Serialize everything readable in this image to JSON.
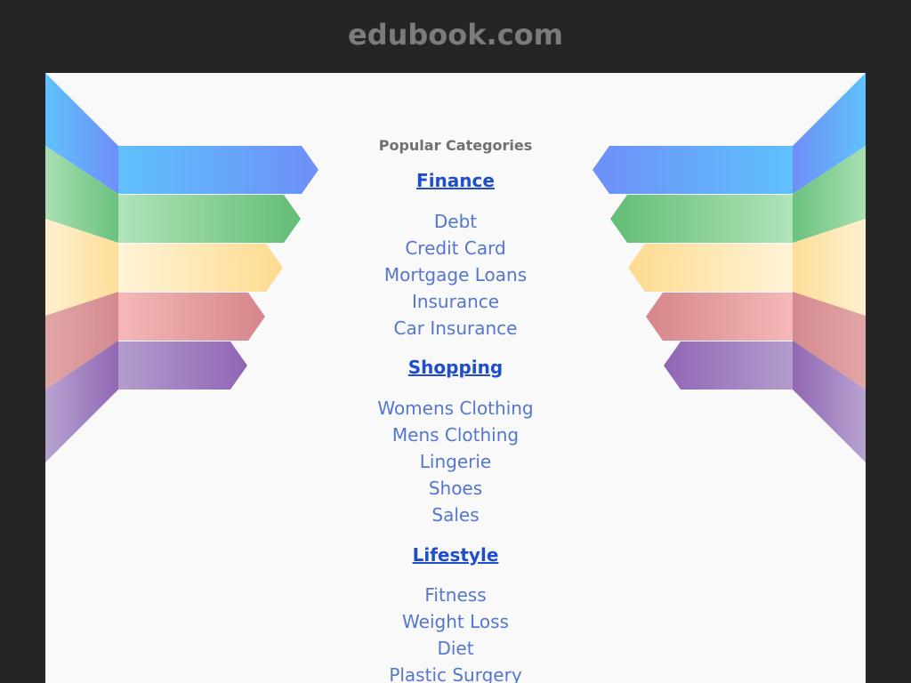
{
  "header": {
    "domain": "edubook.com"
  },
  "content": {
    "heading": "Popular Categories",
    "categories": [
      {
        "title": "Finance",
        "links": [
          "Debt",
          "Credit Card",
          "Mortgage Loans",
          "Insurance",
          "Car Insurance"
        ]
      },
      {
        "title": "Shopping",
        "links": [
          "Womens Clothing",
          "Mens Clothing",
          "Lingerie",
          "Shoes",
          "Sales"
        ]
      },
      {
        "title": "Lifestyle",
        "links": [
          "Fitness",
          "Weight Loss",
          "Diet",
          "Plastic Surgery"
        ]
      }
    ]
  },
  "colors": {
    "background": "#252525",
    "panel": "#f9f9f9",
    "domain_text": "#7b7b7b",
    "heading_text": "#707070",
    "category_link": "#1f4ecc",
    "sub_link": "#5377cf",
    "ribbon_blue": "#5fb8fb",
    "ribbon_green": "#72c783",
    "ribbon_yellow": "#fde29a",
    "ribbon_red": "#df8c8c",
    "ribbon_purple": "#9b77bb"
  }
}
